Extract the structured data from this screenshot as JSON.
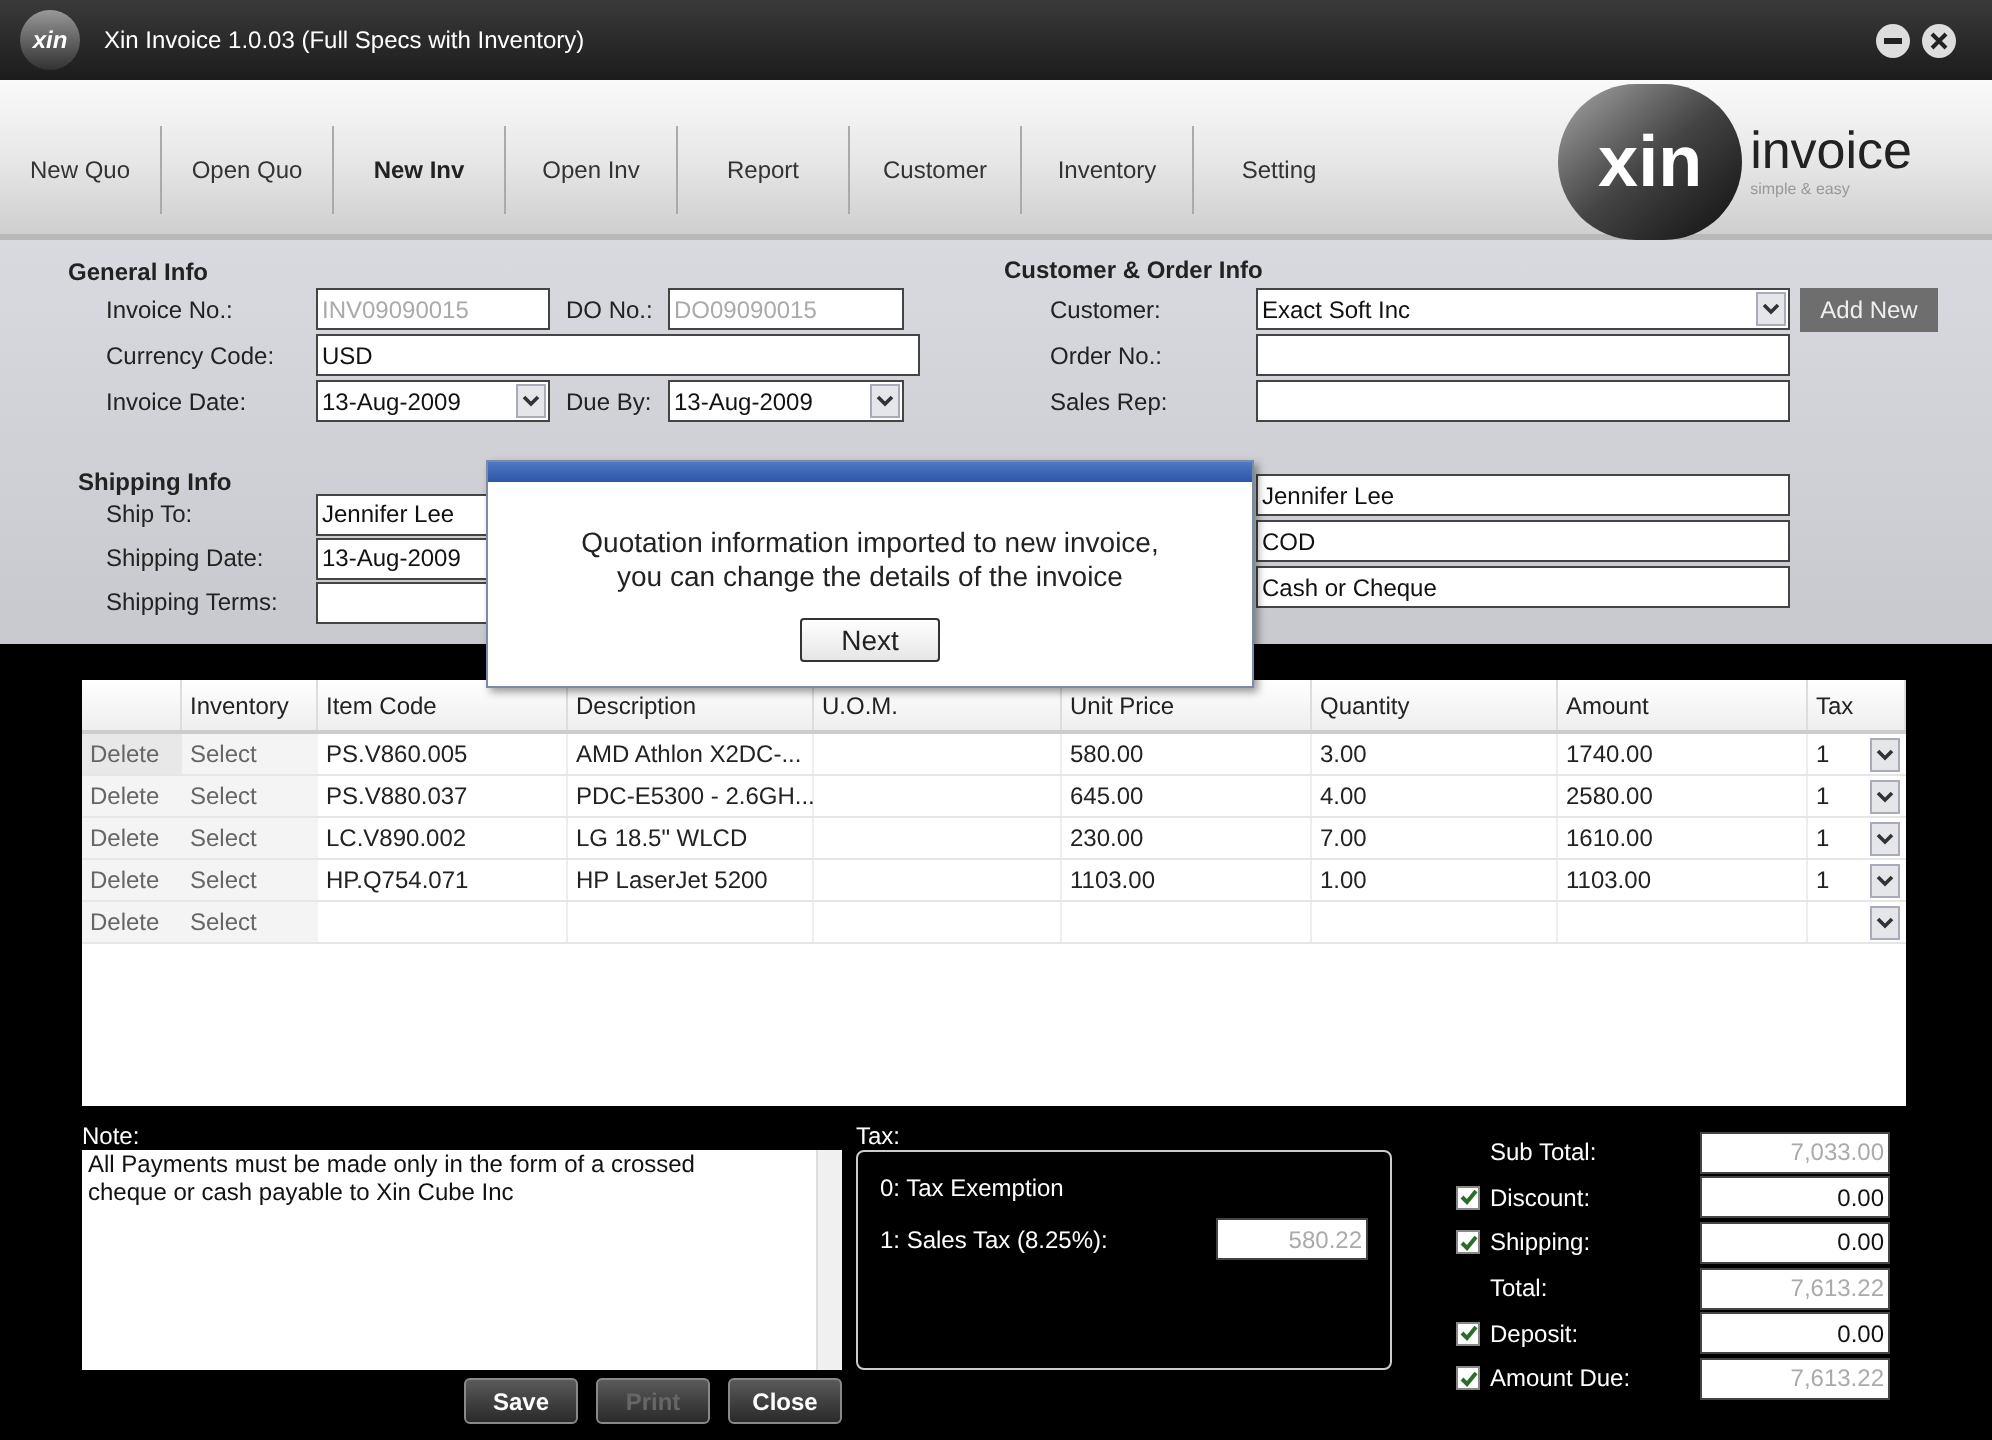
{
  "window": {
    "app_icon": "xin",
    "title": "Xin Invoice 1.0.03 (Full Specs with Inventory)"
  },
  "toolbar": {
    "tabs": [
      {
        "label": "New Quo",
        "selected": false
      },
      {
        "label": "Open Quo",
        "selected": false
      },
      {
        "label": "New Inv",
        "selected": true
      },
      {
        "label": "Open Inv",
        "selected": false
      },
      {
        "label": "Report",
        "selected": false
      },
      {
        "label": "Customer",
        "selected": false
      },
      {
        "label": "Inventory",
        "selected": false
      },
      {
        "label": "Setting",
        "selected": false
      }
    ],
    "logo": {
      "mark": "xin",
      "name": "invoice",
      "tagline": "simple & easy"
    }
  },
  "general_info": {
    "title": "General Info",
    "fields": [
      {
        "label": "Invoice No.:",
        "value": "INV09090015",
        "kind": "text",
        "disabled": true
      },
      {
        "label": "DO No.:",
        "value": "DO09090015",
        "kind": "text",
        "disabled": true
      },
      {
        "label": "Currency Code:",
        "value": "USD",
        "kind": "text",
        "disabled": false
      },
      {
        "label": "Invoice Date:",
        "value": "13-Aug-2009",
        "kind": "dropdown",
        "disabled": false
      },
      {
        "label": "Due By:",
        "value": "13-Aug-2009",
        "kind": "dropdown",
        "disabled": false
      }
    ]
  },
  "customer_info": {
    "title": "Customer & Order Info",
    "fields": [
      {
        "label": "Customer:",
        "value": "Exact Soft Inc",
        "kind": "dropdown"
      },
      {
        "label": "Order No.:",
        "kind": "text"
      },
      {
        "label": "Sales Rep:",
        "kind": "text"
      }
    ],
    "add_button": "Add New"
  },
  "shipping_info": {
    "title": "Shipping Info",
    "rows": [
      {
        "label": "Ship To:",
        "value": "Jennifer Lee",
        "right_value": "Jennifer Lee"
      },
      {
        "label": "Shipping Date:",
        "value": "13-Aug-2009",
        "right_value": "COD"
      },
      {
        "label": "Shipping Terms:",
        "right_value": "Cash or Cheque"
      }
    ]
  },
  "dialog": {
    "lines": [
      "Quotation information imported to new invoice,",
      "you can change the details of the invoice"
    ],
    "button": "Next"
  },
  "table": {
    "columns": [
      "Inventory",
      "Item Code",
      "Description",
      "U.O.M.",
      "Unit Price",
      "Quantity",
      "Amount",
      "Tax"
    ],
    "rows": [
      {
        "delete": "Delete",
        "select": "Select",
        "item_code": "PS.V860.005",
        "description": "AMD Athlon X2DC-...",
        "unit_price": "580.00",
        "quantity": "3.00",
        "amount": "1740.00",
        "tax": "1"
      },
      {
        "delete": "Delete",
        "select": "Select",
        "item_code": "PS.V880.037",
        "description": "PDC-E5300 - 2.6GH...",
        "unit_price": "645.00",
        "quantity": "4.00",
        "amount": "2580.00",
        "tax": "1"
      },
      {
        "delete": "Delete",
        "select": "Select",
        "item_code": "LC.V890.002",
        "description": "LG 18.5\" WLCD",
        "unit_price": "230.00",
        "quantity": "7.00",
        "amount": "1610.00",
        "tax": "1"
      },
      {
        "delete": "Delete",
        "select": "Select",
        "item_code": "HP.Q754.071",
        "description": "HP LaserJet 5200",
        "unit_price": "1103.00",
        "quantity": "1.00",
        "amount": "1103.00",
        "tax": "1"
      },
      {
        "delete": "Delete",
        "select": "Select"
      }
    ]
  },
  "note": {
    "label": "Note:",
    "value": "All Payments must be made only in the form of a crossed cheque or cash payable to Xin Cube Inc"
  },
  "tax": {
    "label": "Tax:",
    "exemption": "0: Tax Exemption",
    "sales_tax_label": "1: Sales Tax (8.25%):",
    "sales_tax_value": "580.22"
  },
  "buttons": [
    {
      "label": "Save",
      "disabled": false
    },
    {
      "label": "Print",
      "disabled": true
    },
    {
      "label": "Close",
      "disabled": false
    }
  ],
  "totals": [
    {
      "label": "Sub Total:",
      "value": "7,033.00",
      "kind": "plain",
      "disabled": true
    },
    {
      "label": "Discount:",
      "value": "0.00",
      "kind": "checkbox",
      "checked": true,
      "disabled": false
    },
    {
      "label": "Shipping:",
      "value": "0.00",
      "kind": "checkbox",
      "checked": true,
      "disabled": false
    },
    {
      "label": "Total:",
      "value": "7,613.22",
      "kind": "plain",
      "disabled": true
    },
    {
      "label": "Deposit:",
      "value": "0.00",
      "kind": "checkbox",
      "checked": true,
      "disabled": false
    },
    {
      "label": "Amount Due:",
      "value": "7,613.22",
      "kind": "checkbox",
      "checked": true,
      "disabled": true
    }
  ]
}
